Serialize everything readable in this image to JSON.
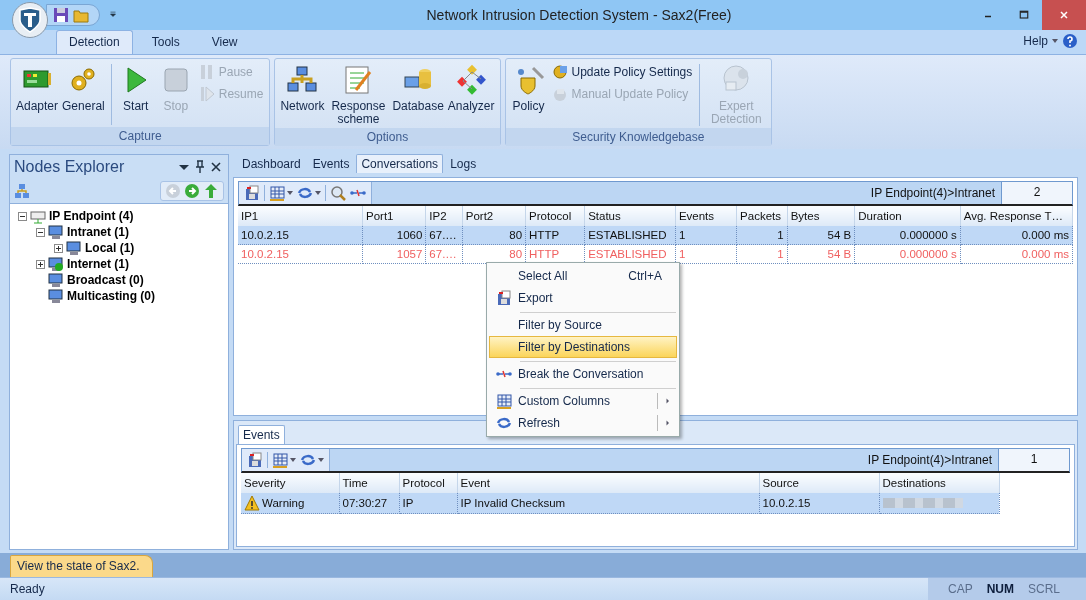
{
  "window": {
    "title": "Network Intrusion Detection System - Sax2(Free)"
  },
  "ribbon": {
    "tabs": [
      {
        "label": "Detection",
        "selected": true
      },
      {
        "label": "Tools",
        "selected": false
      },
      {
        "label": "View",
        "selected": false
      }
    ],
    "help": "Help",
    "groups": [
      {
        "title": "Capture",
        "items": [
          {
            "kind": "large",
            "label": "Adapter",
            "disabled": false
          },
          {
            "kind": "large",
            "label": "General",
            "disabled": false
          },
          {
            "kind": "separator"
          },
          {
            "kind": "large",
            "label": "Start",
            "disabled": false
          },
          {
            "kind": "large",
            "label": "Stop",
            "disabled": true
          },
          {
            "kind": "small",
            "label": "Pause",
            "disabled": true
          },
          {
            "kind": "small",
            "label": "Resume",
            "disabled": true
          }
        ]
      },
      {
        "title": "Options",
        "items": [
          {
            "kind": "large",
            "label": "Network",
            "disabled": false
          },
          {
            "kind": "large",
            "label": "Response scheme",
            "disabled": false
          },
          {
            "kind": "large",
            "label": "Database",
            "disabled": false
          },
          {
            "kind": "large",
            "label": "Analyzer",
            "disabled": false
          }
        ]
      },
      {
        "title": "Security Knowledgebase",
        "items": [
          {
            "kind": "large",
            "label": "Policy",
            "disabled": false
          },
          {
            "kind": "small",
            "label": "Update Policy Settings",
            "disabled": false
          },
          {
            "kind": "small",
            "label": "Manual Update Policy",
            "disabled": true
          },
          {
            "kind": "separator"
          },
          {
            "kind": "large",
            "label": "Expert Detection",
            "disabled": true
          }
        ]
      }
    ]
  },
  "nodes_explorer": {
    "title": "Nodes Explorer",
    "tree": [
      {
        "label": "IP Endpoint (4)",
        "kind": "branch",
        "expanded": true,
        "children": [
          {
            "label": "Intranet (1)",
            "kind": "branch",
            "expanded": true,
            "children": [
              {
                "label": "Local (1)",
                "kind": "branch",
                "expanded": false
              }
            ]
          },
          {
            "label": "Internet (1)",
            "kind": "branch",
            "expanded": false
          },
          {
            "label": "Broadcast (0)",
            "kind": "leaf"
          },
          {
            "label": "Multicasting (0)",
            "kind": "leaf"
          }
        ]
      }
    ]
  },
  "doc_tabs": [
    {
      "label": "Dashboard",
      "selected": false
    },
    {
      "label": "Events",
      "selected": false
    },
    {
      "label": "Conversations",
      "selected": true
    },
    {
      "label": "Logs",
      "selected": false
    }
  ],
  "conversations": {
    "path": "IP Endpoint(4)>Intranet",
    "count": "2",
    "columns": [
      "IP1",
      "Port1",
      "IP2",
      "Port2",
      "Protocol",
      "Status",
      "Events",
      "Packets",
      "Bytes",
      "Duration",
      "Avg. Response T…"
    ],
    "rows": [
      {
        "cells": [
          "10.0.2.15",
          "1060",
          "67.…",
          "80",
          "HTTP",
          "ESTABLISHED",
          "1",
          "1",
          "54 B",
          "0.000000 s",
          "0.000 ms"
        ],
        "selected": true,
        "flagged": false
      },
      {
        "cells": [
          "10.0.2.15",
          "1057",
          "67.…",
          "80",
          "HTTP",
          "ESTABLISHED",
          "1",
          "1",
          "54 B",
          "0.000000 s",
          "0.000 ms"
        ],
        "selected": false,
        "flagged": true
      }
    ]
  },
  "context_menu": [
    {
      "label": "Select All",
      "shortcut": "Ctrl+A",
      "separator_before": false,
      "submenu": false,
      "selected": false
    },
    {
      "label": "Export",
      "separator_before": false,
      "submenu": false,
      "selected": false
    },
    {
      "label": "Filter by Source",
      "separator_before": true,
      "submenu": false,
      "selected": false
    },
    {
      "label": "Filter by Destinations",
      "separator_before": false,
      "submenu": false,
      "selected": true
    },
    {
      "label": "Break the Conversation",
      "separator_before": true,
      "submenu": false,
      "selected": false
    },
    {
      "label": "Custom Columns",
      "separator_before": true,
      "submenu": true,
      "selected": false
    },
    {
      "label": "Refresh",
      "separator_before": false,
      "submenu": true,
      "selected": false
    }
  ],
  "events": {
    "tab": "Events",
    "path": "IP Endpoint(4)>Intranet",
    "count": "1",
    "columns": [
      "Severity",
      "Time",
      "Protocol",
      "Event",
      "Source",
      "Destinations"
    ],
    "rows": [
      {
        "cells": [
          "Warning",
          "07:30:27",
          "IP",
          "IP Invalid Checksum",
          "10.0.2.15"
        ],
        "selected": true,
        "destination_blurred": true
      }
    ]
  },
  "bottom_tab": "View the state of Sax2.",
  "status_bar": {
    "text": "Ready",
    "indicators": [
      {
        "label": "CAP",
        "on": false
      },
      {
        "label": "NUM",
        "on": true
      },
      {
        "label": "SCRL",
        "on": false
      }
    ]
  }
}
